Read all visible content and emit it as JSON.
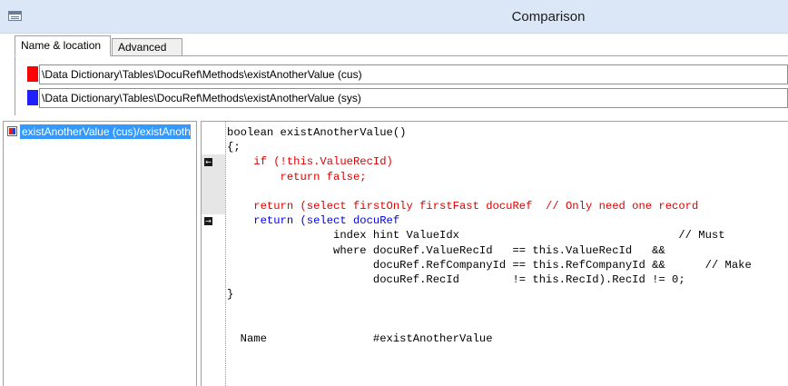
{
  "window": {
    "title": "Comparison"
  },
  "tabs": [
    {
      "label": "Name & location",
      "active": true
    },
    {
      "label": "Advanced",
      "active": false
    }
  ],
  "paths": [
    {
      "color": "#ff0000",
      "value": "\\Data Dictionary\\Tables\\DocuRef\\Methods\\existAnotherValue (cus)"
    },
    {
      "color": "#2020ff",
      "value": "\\Data Dictionary\\Tables\\DocuRef\\Methods\\existAnotherValue (sys)"
    }
  ],
  "tree": {
    "selected_item": "existAnotherValue (cus)/existAnotherValue (sys)"
  },
  "colors": {
    "cus": "#e00000",
    "sys": "#0000ee",
    "selection": "#3399ff"
  },
  "code_lines": [
    {
      "text": "boolean existAnotherValue()",
      "color": "black"
    },
    {
      "text": "{;",
      "color": "black"
    },
    {
      "text": "    if (!this.ValueRecId)",
      "color": "red"
    },
    {
      "text": "        return false;",
      "color": "red"
    },
    {
      "text": "",
      "color": "red"
    },
    {
      "text": "    return (select firstOnly firstFast docuRef  // Only need one record",
      "color": "red"
    },
    {
      "text": "    return (select docuRef",
      "color": "blue"
    },
    {
      "text": "                index hint ValueIdx                                 // Must",
      "color": "black"
    },
    {
      "text": "                where docuRef.ValueRecId   == this.ValueRecId   &&",
      "color": "black"
    },
    {
      "text": "                      docuRef.RefCompanyId == this.RefCompanyId &&      // Make",
      "color": "black"
    },
    {
      "text": "                      docuRef.RecId        != this.RecId).RecId != 0;",
      "color": "black"
    },
    {
      "text": "}",
      "color": "black"
    },
    {
      "text": "",
      "color": "black"
    },
    {
      "text": "",
      "color": "black"
    },
    {
      "text": "  Name                #existAnotherValue",
      "color": "black"
    }
  ],
  "markers": [
    {
      "icon": "arrow-left-icon",
      "glyph": "←"
    },
    {
      "icon": "arrow-right-icon",
      "glyph": "→"
    }
  ]
}
